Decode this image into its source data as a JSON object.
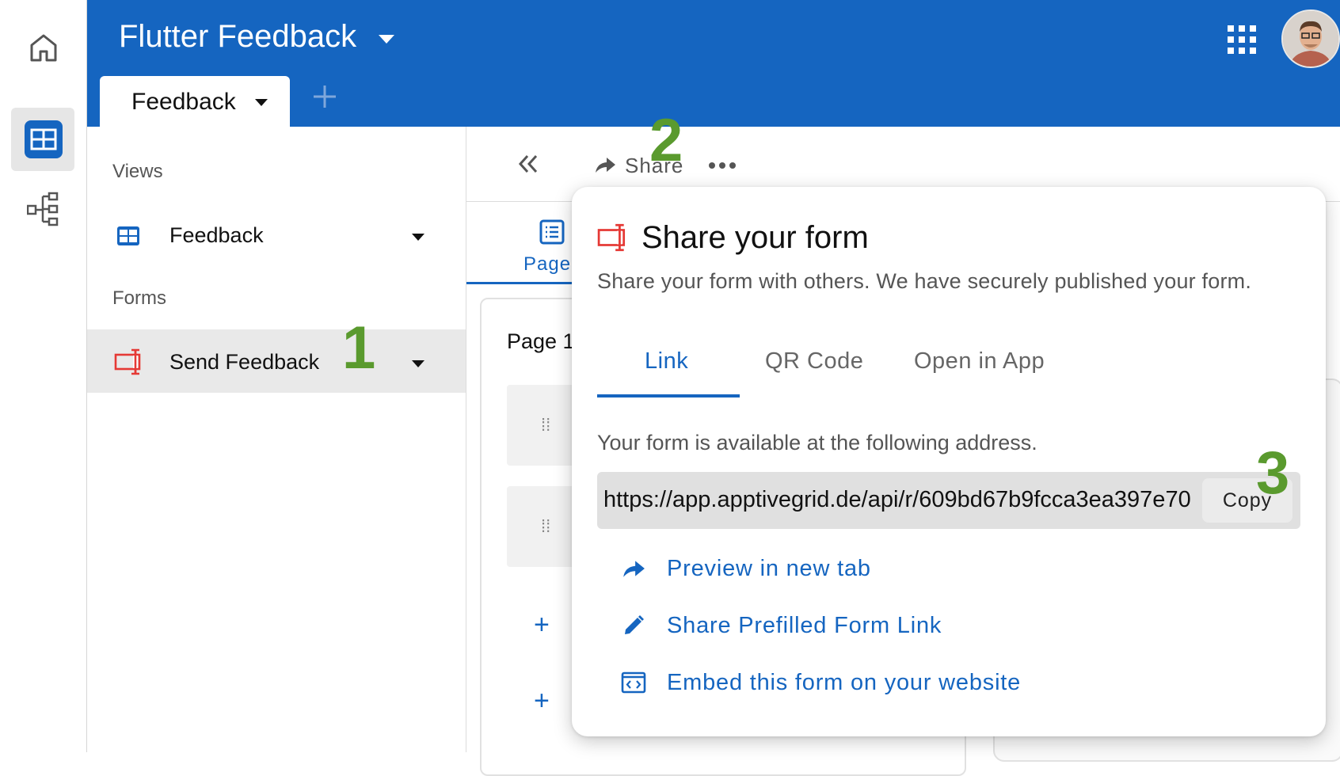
{
  "header": {
    "app_title": "Flutter Feedback",
    "tab": "Feedback",
    "bg_color": "#1565c0"
  },
  "rail": {
    "items": [
      {
        "icon": "home-icon"
      },
      {
        "icon": "grid-icon",
        "active": true
      },
      {
        "icon": "tree-icon"
      }
    ]
  },
  "sidebar": {
    "views_label": "Views",
    "view_item": "Feedback",
    "forms_label": "Forms",
    "form_item": "Send Feedback"
  },
  "toolbar": {
    "share_label": "Share"
  },
  "editor": {
    "page_tab": "Page",
    "page_label": "Page 1"
  },
  "annotations": {
    "one": "1",
    "two": "2",
    "three": "3",
    "color": "#5a9a2e"
  },
  "popup": {
    "title": "Share your form",
    "subtitle": "Share your form with others. We have securely published your form.",
    "tabs": [
      "Link",
      "QR Code",
      "Open in App"
    ],
    "active_tab": "Link",
    "address_label": "Your form is available at the following address.",
    "url": "https://app.apptivegrid.de/api/r/609bd67b9fcca3ea397e70",
    "copy_label": "Copy",
    "actions": [
      {
        "label": "Preview in new tab",
        "icon": "share-arrow-icon"
      },
      {
        "label": "Share Prefilled Form Link",
        "icon": "pencil-icon"
      },
      {
        "label": "Embed this form on your website",
        "icon": "embed-icon"
      }
    ]
  }
}
